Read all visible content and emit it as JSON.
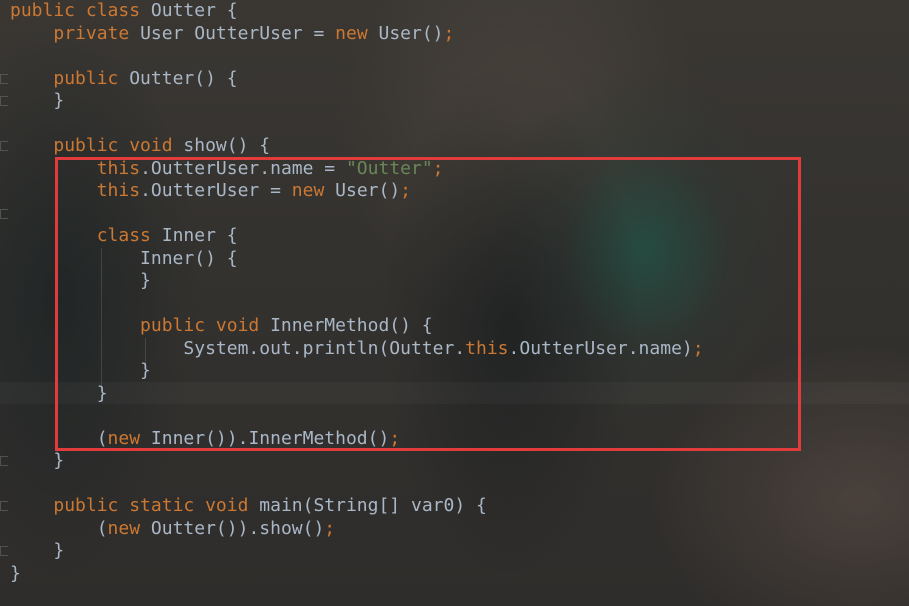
{
  "editor": {
    "lines": [
      [
        {
          "t": "public ",
          "c": "kw"
        },
        {
          "t": "class ",
          "c": "kw"
        },
        {
          "t": "Outter {",
          "c": ""
        }
      ],
      [
        {
          "t": "    ",
          "c": ""
        },
        {
          "t": "private ",
          "c": "kw"
        },
        {
          "t": "User OutterUser = ",
          "c": ""
        },
        {
          "t": "new ",
          "c": "kw"
        },
        {
          "t": "User()",
          "c": ""
        },
        {
          "t": ";",
          "c": "kw"
        }
      ],
      [],
      [
        {
          "t": "    ",
          "c": ""
        },
        {
          "t": "public ",
          "c": "kw"
        },
        {
          "t": "Outter() {",
          "c": ""
        }
      ],
      [
        {
          "t": "    }",
          "c": ""
        }
      ],
      [],
      [
        {
          "t": "    ",
          "c": ""
        },
        {
          "t": "public ",
          "c": "kw"
        },
        {
          "t": "void ",
          "c": "kw"
        },
        {
          "t": "show() {",
          "c": ""
        }
      ],
      [
        {
          "t": "        ",
          "c": ""
        },
        {
          "t": "this",
          "c": "kw"
        },
        {
          "t": ".OutterUser.name = ",
          "c": ""
        },
        {
          "t": "\"Outter\"",
          "c": "str"
        },
        {
          "t": ";",
          "c": "kw"
        }
      ],
      [
        {
          "t": "        ",
          "c": ""
        },
        {
          "t": "this",
          "c": "kw"
        },
        {
          "t": ".OutterUser = ",
          "c": ""
        },
        {
          "t": "new ",
          "c": "kw"
        },
        {
          "t": "User()",
          "c": ""
        },
        {
          "t": ";",
          "c": "kw"
        }
      ],
      [],
      [
        {
          "t": "        ",
          "c": ""
        },
        {
          "t": "class ",
          "c": "kw"
        },
        {
          "t": "Inner {",
          "c": ""
        }
      ],
      [
        {
          "t": "            Inner() {",
          "c": ""
        }
      ],
      [
        {
          "t": "            }",
          "c": ""
        }
      ],
      [],
      [
        {
          "t": "            ",
          "c": ""
        },
        {
          "t": "public ",
          "c": "kw"
        },
        {
          "t": "void ",
          "c": "kw"
        },
        {
          "t": "InnerMethod() {",
          "c": ""
        }
      ],
      [
        {
          "t": "                System.out.println(Outter.",
          "c": ""
        },
        {
          "t": "this",
          "c": "kw"
        },
        {
          "t": ".OutterUser.name)",
          "c": ""
        },
        {
          "t": ";",
          "c": "kw"
        }
      ],
      [
        {
          "t": "            }",
          "c": ""
        }
      ],
      [
        {
          "t": "        }",
          "c": ""
        }
      ],
      [],
      [
        {
          "t": "        (",
          "c": ""
        },
        {
          "t": "new ",
          "c": "kw"
        },
        {
          "t": "Inner()).InnerMethod()",
          "c": ""
        },
        {
          "t": ";",
          "c": "kw"
        }
      ],
      [
        {
          "t": "    }",
          "c": ""
        }
      ],
      [],
      [
        {
          "t": "    ",
          "c": ""
        },
        {
          "t": "public ",
          "c": "kw"
        },
        {
          "t": "static ",
          "c": "kw"
        },
        {
          "t": "void ",
          "c": "kw"
        },
        {
          "t": "main(String[] var0) {",
          "c": ""
        }
      ],
      [
        {
          "t": "        (",
          "c": ""
        },
        {
          "t": "new ",
          "c": "kw"
        },
        {
          "t": "Outter()).show()",
          "c": ""
        },
        {
          "t": ";",
          "c": "kw"
        }
      ],
      [
        {
          "t": "    }",
          "c": ""
        }
      ],
      [
        {
          "t": "}",
          "c": ""
        }
      ]
    ]
  },
  "colors": {
    "keyword": "#cc7832",
    "plain": "#a9b7c6",
    "string": "#6a8759",
    "highlight_border": "#e23b3b"
  }
}
